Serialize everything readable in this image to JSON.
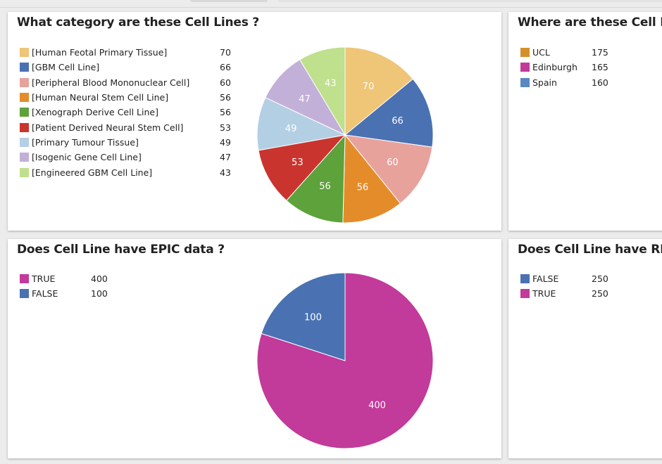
{
  "chart_data": [
    {
      "type": "pie",
      "title": "What category are these Cell Lines ?",
      "categories": [
        "[Human Feotal Primary Tissue]",
        "[GBM Cell Line]",
        "[Peripheral Blood Mononuclear Cell]",
        "[Human Neural Stem Cell Line]",
        "[Xenograph Derive Cell Line]",
        "[Patient Derived Neural Stem Cell]",
        "[Primary Tumour Tissue]",
        "[Isogenic Gene Cell Line]",
        "[Engineered GBM Cell Line]"
      ],
      "values": [
        70,
        66,
        60,
        56,
        56,
        53,
        49,
        47,
        43
      ],
      "colors": [
        "#efc577",
        "#4a72b2",
        "#e8a29c",
        "#e58c2a",
        "#5da23a",
        "#c9352e",
        "#b3cfe4",
        "#c3b0d8",
        "#bfe08c"
      ],
      "slice_labels": [
        "70",
        "66",
        "60",
        "56",
        "56",
        "53",
        "49",
        "47",
        "43"
      ],
      "legend": "left"
    },
    {
      "type": "pie",
      "title": "Where are these Cell Lin",
      "categories": [
        "UCL",
        "Edinburgh",
        "Spain"
      ],
      "values": [
        175,
        165,
        160
      ],
      "colors": [
        "#d4902a",
        "#c23a9a",
        "#5a87c4"
      ],
      "legend": "left"
    },
    {
      "type": "pie",
      "title": "Does Cell Line have EPIC data ?",
      "categories": [
        "TRUE",
        "FALSE"
      ],
      "values": [
        400,
        100
      ],
      "colors": [
        "#c23a9a",
        "#4a72b2"
      ],
      "slice_labels": [
        "400",
        "100"
      ],
      "legend": "left"
    },
    {
      "type": "pie",
      "title": "Does Cell Line have RNA",
      "categories": [
        "FALSE",
        "TRUE"
      ],
      "values": [
        250,
        250
      ],
      "colors": [
        "#4a72b2",
        "#c23a9a"
      ],
      "legend": "left"
    }
  ]
}
